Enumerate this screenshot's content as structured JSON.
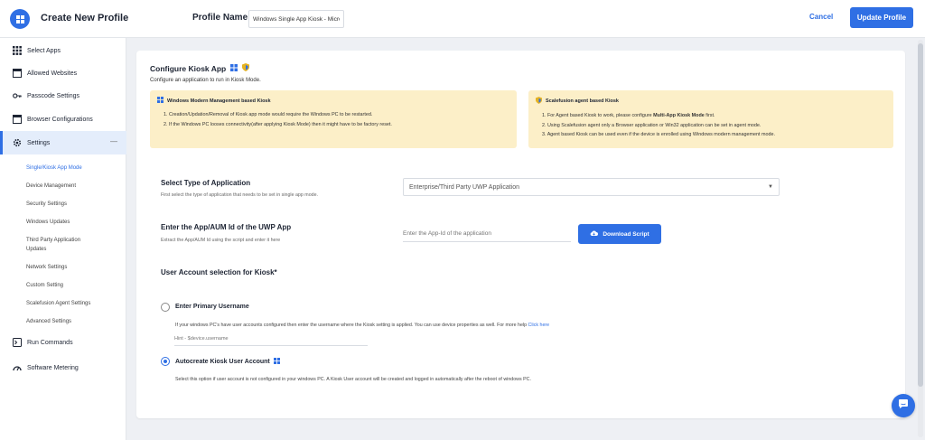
{
  "header": {
    "title": "Create New Profile",
    "profile_label": "Profile Name",
    "profile_value": "Windows Single App Kiosk - Micro",
    "cancel_label": "Cancel",
    "update_label": "Update Profile"
  },
  "colors": {
    "accent": "#2f6fe4",
    "note_bg": "#fcefc8",
    "active_bg": "#e4edfb"
  },
  "sidebar": {
    "items": [
      {
        "label": "Select Apps",
        "icon": "grid-icon"
      },
      {
        "label": "Allowed Websites",
        "icon": "browser-window-icon"
      },
      {
        "label": "Passcode Settings",
        "icon": "key-icon"
      },
      {
        "label": "Browser Configurations",
        "icon": "browser-window-icon"
      },
      {
        "label": "Settings",
        "icon": "gear-icon",
        "expanded": true
      },
      {
        "label": "Run Commands",
        "icon": "terminal-icon"
      },
      {
        "label": "Software Metering",
        "icon": "gauge-icon"
      }
    ],
    "collapse_symbol": "—",
    "settings_sub": [
      "Single/Kiosk App Mode",
      "Device Management",
      "Security Settings",
      "Windows Updates",
      "Third Party Application Updates",
      "Network Settings",
      "Custom Setting",
      "Scalefusion Agent Settings",
      "Advanced Settings"
    ]
  },
  "main": {
    "title": "Configure Kiosk App",
    "subtitle": "Configure an application to run in Kiosk Mode.",
    "note_left": {
      "title": "Windows Modern Management based Kiosk",
      "items": [
        "1. Creation/Updation/Removal of Kiosk app mode would require the Windows PC to be restarted.",
        "2. If the Windows PC looses connectivity(after applying Kiosk Mode) then it might have to be factory reset."
      ]
    },
    "note_right": {
      "title": "Scalefusion agent based Kiosk",
      "item1_prefix": "1. For Agent based Kiosk to work, please configure ",
      "item1_bold": "Multi-App Kiosk Mode",
      "item1_suffix": " first.",
      "item2": "2. Using Scalefusion agent only a Browser application or Win32 application can be set in agent mode.",
      "item3": "3. Agent based Kiosk can be used even if the device is enrolled using Windows modern management mode."
    },
    "select_type": {
      "title": "Select Type of Application",
      "help": "First select the type of application that needs to be set in single app mode.",
      "value": "Enterprise/Third Party UWP Application"
    },
    "app_id": {
      "title": "Enter the App/AUM Id of the UWP App",
      "help": "Extract the App/AUM Id using the script and enter it here",
      "placeholder": "Enter the App-Id of the application",
      "download_label": "Download Script"
    },
    "user_account": {
      "title": "User Account selection for Kiosk*",
      "option1": {
        "label": "Enter Primary Username",
        "help": "If your windows PC's have user accounts configured then enter the username where the Kiosk setting is applied. You can use device properties as well. For more help ",
        "link": "Click here",
        "hint_placeholder": "Hint - $device.username",
        "checked": false
      },
      "option2": {
        "label": "Autocreate Kiosk User Account",
        "help": "Select this option if user account is not configured in your windows PC. A Kiosk User account will be created and logged in automatically after the reboot of windows PC.",
        "checked": true
      }
    }
  }
}
